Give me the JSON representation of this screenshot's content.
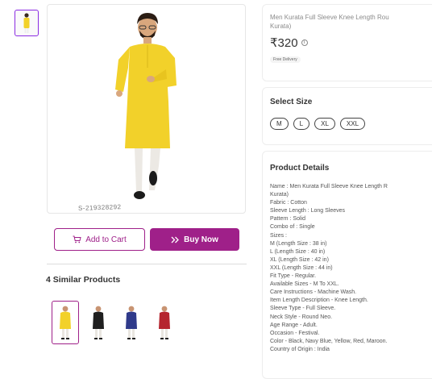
{
  "gallery": {
    "watermark": "S-219328292"
  },
  "actions": {
    "add_to_cart": "Add to Cart",
    "buy_now": "Buy Now"
  },
  "similar": {
    "title": "4 Similar Products",
    "items": [
      {
        "color": "#f2d12a",
        "active": true
      },
      {
        "color": "#1f1f1f",
        "active": false
      },
      {
        "color": "#2f3a8a",
        "active": false
      },
      {
        "color": "#b5252f",
        "active": false
      }
    ]
  },
  "product": {
    "title_line1": "Men Kurata Full Sleeve Knee Length Rou",
    "title_line2": "Kurata)",
    "price": "₹320",
    "delivery_badge": "Free Delivery"
  },
  "size_section": {
    "title": "Select Size",
    "sizes": [
      "M",
      "L",
      "XL",
      "XXL"
    ]
  },
  "details_section": {
    "title": "Product Details",
    "lines": [
      "Name : Men Kurata Full Sleeve Knee Length R",
      "Kurata)",
      "Fabric : Cotton",
      "Sleeve Length : Long Sleeves",
      "Pattern : Solid",
      "Combo of : Single",
      "Sizes :",
      "M (Length Size : 38 in)",
      "L (Length Size : 40 in)",
      "XL (Length Size : 42 in)",
      "XXL (Length Size : 44 in)",
      "Fit Type - Regular.",
      "Available Sizes - M To XXL.",
      "Care Instructions - Machine Wash.",
      "Item Length Description - Knee Length.",
      "Sleeve Type - Full Sleeve.",
      "Neck Style - Round Neo.",
      "Age Range - Adult.",
      "Occasion - Festival.",
      "Color - Black, Navy Blue, Yellow, Red, Maroon.",
      "Country of Origin : India"
    ]
  },
  "colors": {
    "accent": "#9f2089",
    "kurta_yellow": "#f2d12a"
  }
}
